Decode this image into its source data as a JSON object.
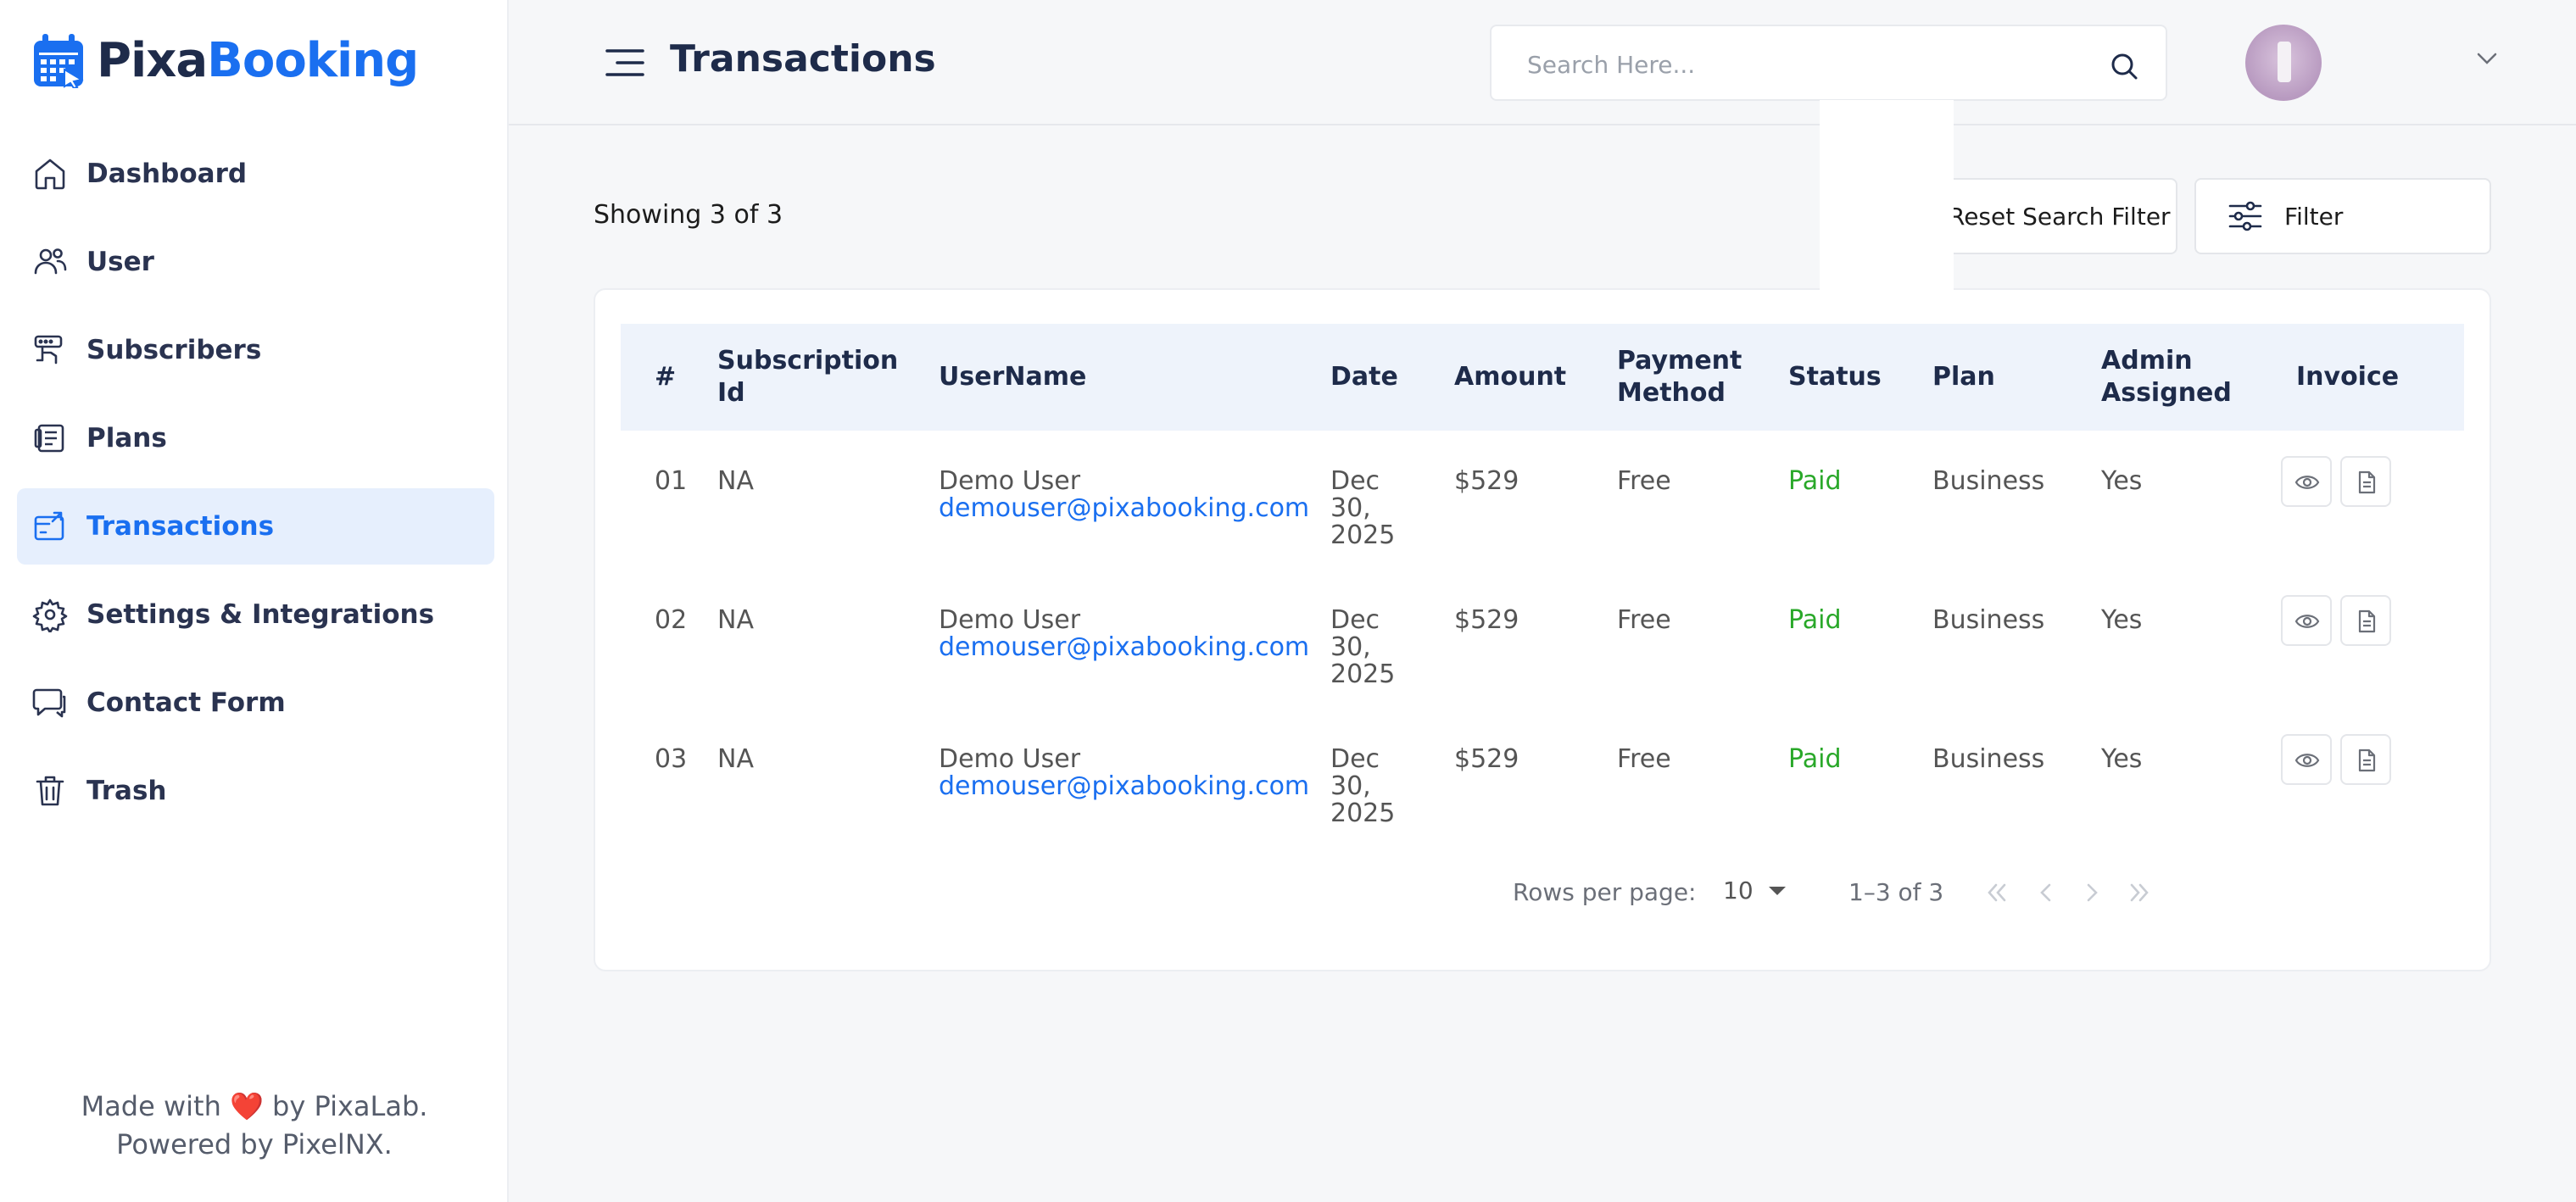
{
  "brand": {
    "part1": "Pixa",
    "part2": "Booking"
  },
  "sidebar": {
    "items": [
      {
        "label": "Dashboard",
        "icon": "home-icon"
      },
      {
        "label": "User",
        "icon": "users-icon"
      },
      {
        "label": "Subscribers",
        "icon": "subscribers-icon"
      },
      {
        "label": "Plans",
        "icon": "plans-icon"
      },
      {
        "label": "Transactions",
        "icon": "transactions-icon",
        "active": true
      },
      {
        "label": "Settings & Integrations",
        "icon": "gear-icon"
      },
      {
        "label": "Contact Form",
        "icon": "chat-icon"
      },
      {
        "label": "Trash",
        "icon": "trash-icon"
      }
    ],
    "credits_line1_pre": "Made with",
    "credits_heart": "❤️",
    "credits_line1_post": "by PixaLab.",
    "credits_line2": "Powered by PixelNX."
  },
  "header": {
    "title": "Transactions",
    "search_placeholder": "Search Here..."
  },
  "toolbar": {
    "showing": "Showing 3 of 3",
    "reset_label": "Reset Search Filter",
    "filter_label": "Filter"
  },
  "table": {
    "headers": [
      "#",
      "Subscription Id",
      "UserName",
      "Date",
      "Amount",
      "Payment Method",
      "Status",
      "Plan",
      "Admin Assigned",
      "Invoice"
    ],
    "rows": [
      {
        "num": "01",
        "sub_id": "NA",
        "name": "Demo User",
        "email": "demouser@pixabooking.com",
        "date_l1": "Dec",
        "date_l2": "30,",
        "date_l3": "2025",
        "amount": "$529",
        "method": "Free",
        "status": "Paid",
        "plan": "Business",
        "admin": "Yes"
      },
      {
        "num": "02",
        "sub_id": "NA",
        "name": "Demo User",
        "email": "demouser@pixabooking.com",
        "date_l1": "Dec",
        "date_l2": "30,",
        "date_l3": "2025",
        "amount": "$529",
        "method": "Free",
        "status": "Paid",
        "plan": "Business",
        "admin": "Yes"
      },
      {
        "num": "03",
        "sub_id": "NA",
        "name": "Demo User",
        "email": "demouser@pixabooking.com",
        "date_l1": "Dec",
        "date_l2": "30,",
        "date_l3": "2025",
        "amount": "$529",
        "method": "Free",
        "status": "Paid",
        "plan": "Business",
        "admin": "Yes"
      }
    ]
  },
  "pagination": {
    "rows_label": "Rows per page:",
    "rows_value": "10",
    "range": "1–3 of 3"
  },
  "colors": {
    "accent": "#1a6ff0",
    "paid": "#29a829",
    "active_bg": "#e6effd"
  }
}
